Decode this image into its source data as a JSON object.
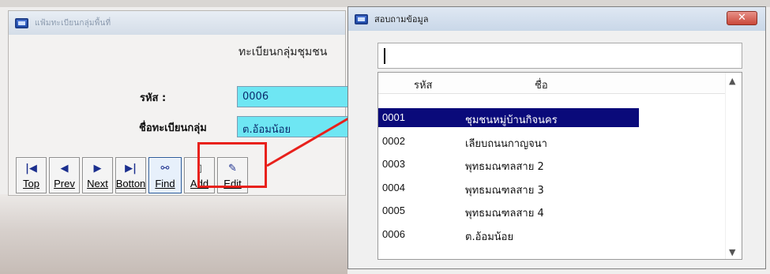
{
  "main_window": {
    "title": "แฟ้มทะเบียนกลุ่มพื้นที่",
    "heading": "ทะเบียนกลุ่มชุมชน",
    "code_label": "รหัส :",
    "code_value": "0006",
    "name_label": "ชื่อทะเบียนกลุ่ม",
    "name_value": "ต.อ้อมน้อย",
    "toolbar": [
      {
        "label": "Top",
        "icon": "first-record-icon"
      },
      {
        "label": "Prev",
        "icon": "previous-record-icon"
      },
      {
        "label": "Next",
        "icon": "next-record-icon"
      },
      {
        "label": "Botton",
        "icon": "last-record-icon"
      },
      {
        "label": "Find",
        "icon": "binoculars-icon"
      },
      {
        "label": "Add",
        "icon": "new-document-icon"
      },
      {
        "label": "Edit",
        "icon": "edit-icon"
      }
    ]
  },
  "dialog": {
    "title": "สอบถามข้อมูล",
    "close_label": "✕",
    "search_value": "",
    "columns": [
      "รหัส",
      "ชื่อ"
    ],
    "rows": [
      {
        "code": "0001",
        "name": "ชุมชนหมู่บ้านกิจนคร",
        "selected": true
      },
      {
        "code": "0002",
        "name": "เลียบถนนกาญจนา",
        "selected": false
      },
      {
        "code": "0003",
        "name": "พุทธมณฑลสาย 2",
        "selected": false
      },
      {
        "code": "0004",
        "name": "พุทธมณฑลสาย 3",
        "selected": false
      },
      {
        "code": "0005",
        "name": "พุทธมณฑลสาย 4",
        "selected": false
      },
      {
        "code": "0006",
        "name": "ต.อ้อมน้อย",
        "selected": false
      }
    ]
  },
  "colors": {
    "field_bg": "#6ee6f3",
    "selection_bg": "#0a0a7a",
    "highlight": "#e8211c"
  }
}
